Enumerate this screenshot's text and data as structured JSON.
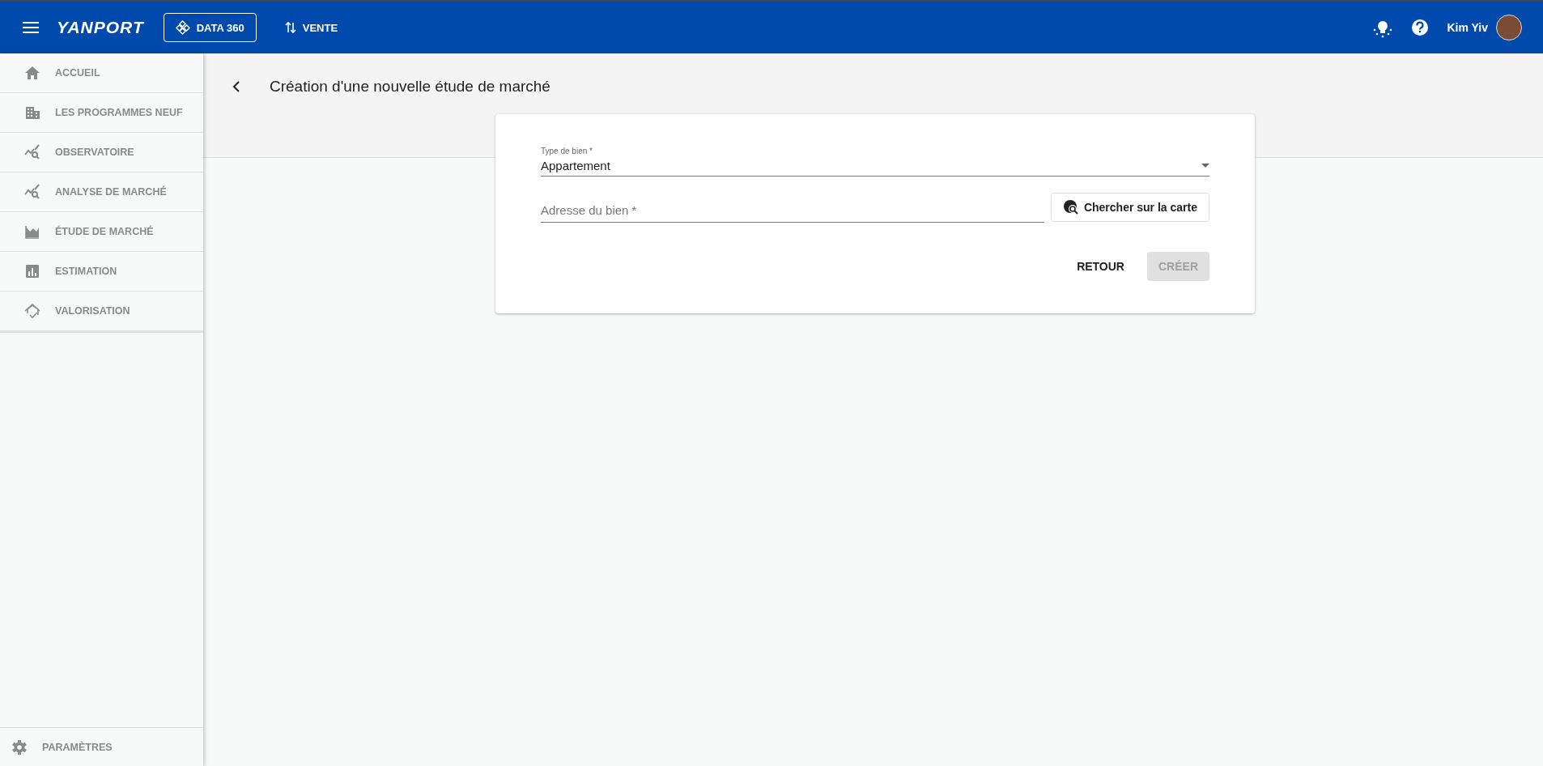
{
  "header": {
    "logo": "YANPORT",
    "nav": [
      {
        "label": "DATA 360",
        "kind": "data",
        "selected": true
      },
      {
        "label": "VENTE",
        "kind": "swap",
        "selected": false
      }
    ],
    "user": {
      "name": "Kim Yiv"
    }
  },
  "sidebar": {
    "items": [
      {
        "label": "ACCUEIL",
        "kind": "home"
      },
      {
        "label": "LES PROGRAMMES NEUF",
        "kind": "building"
      },
      {
        "label": "OBSERVATOIRE",
        "kind": "chart"
      },
      {
        "label": "ANALYSE DE MARCHÉ",
        "kind": "chart"
      },
      {
        "label": "ÉTUDE DE MARCHÉ",
        "kind": "area"
      },
      {
        "label": "ESTIMATION",
        "kind": "bars"
      },
      {
        "label": "VALORISATION",
        "kind": "house"
      }
    ],
    "footer": {
      "label": "PARAMÈTRES"
    }
  },
  "page": {
    "title": "Création d'une nouvelle étude de marché"
  },
  "form": {
    "type_field": {
      "label": "Type de bien *",
      "value": "Appartement"
    },
    "address_field": {
      "placeholder": "Adresse du bien *"
    },
    "map_button": "Chercher sur la carte",
    "actions": [
      {
        "label": "RETOUR",
        "disabled": false
      },
      {
        "label": "CRÉER",
        "disabled": true
      }
    ]
  }
}
